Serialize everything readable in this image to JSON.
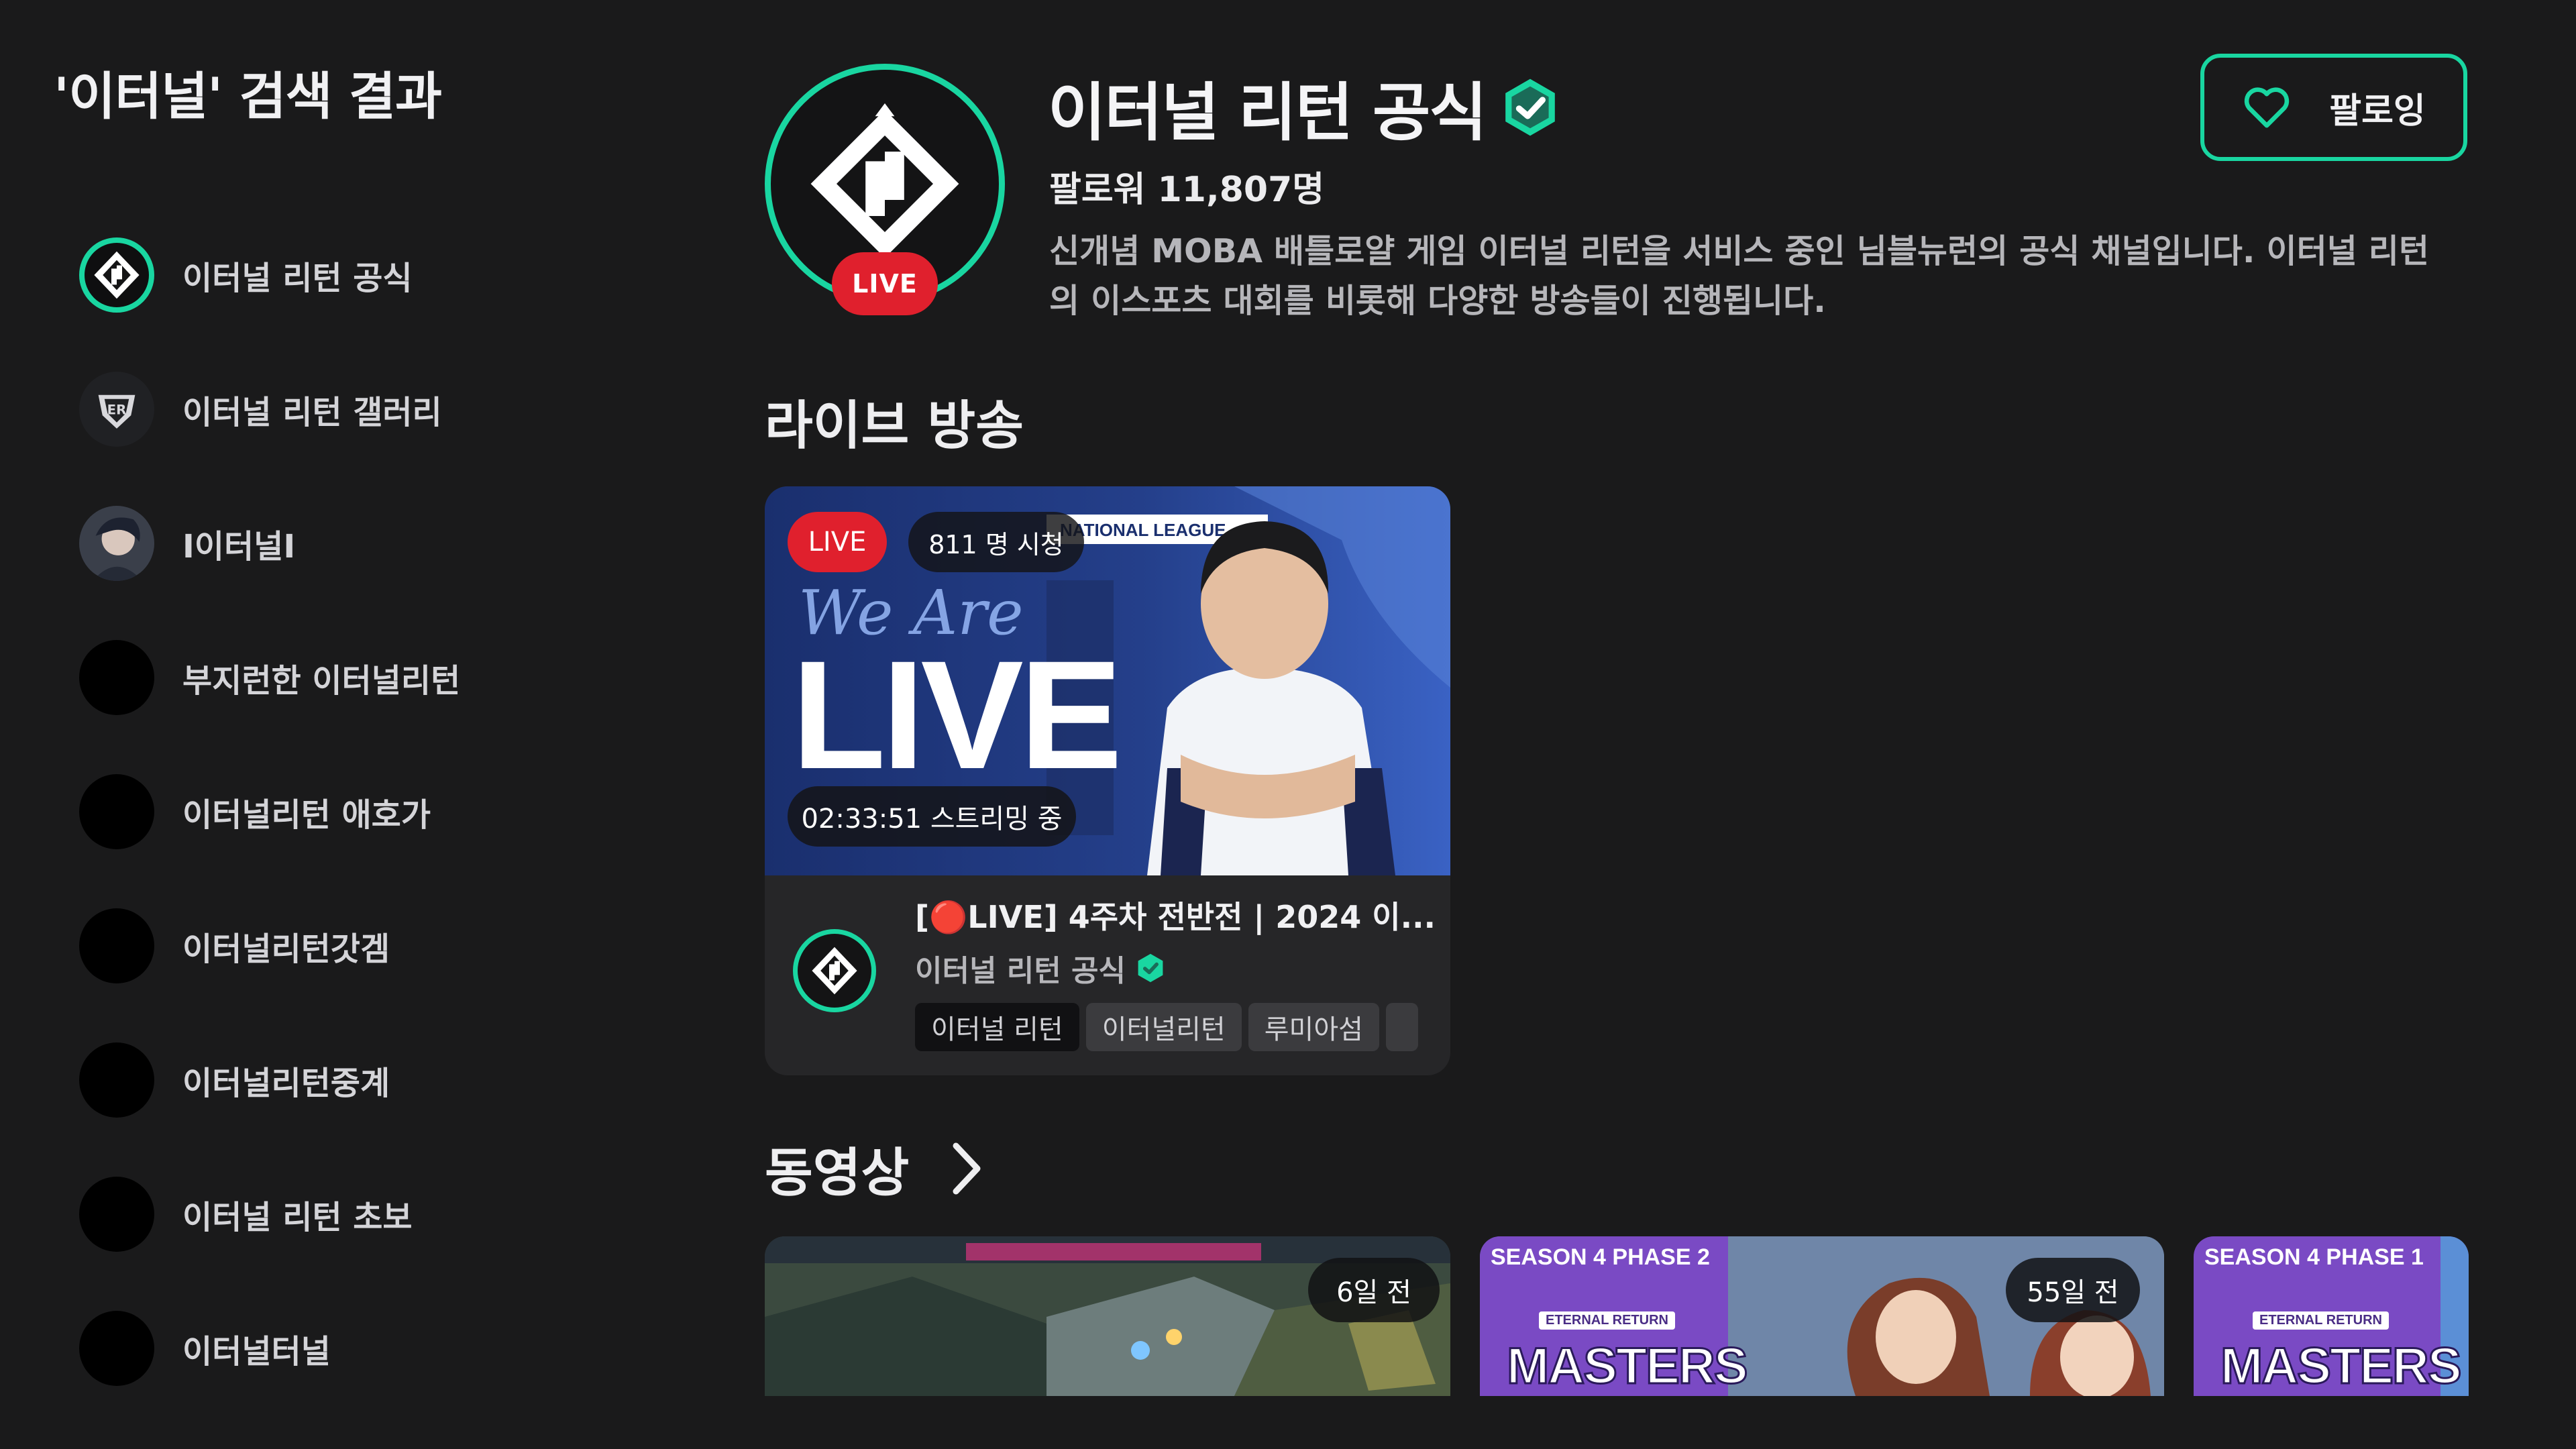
{
  "sidebar": {
    "search_title": "'이터널' 검색 결과",
    "items": [
      {
        "label": "이터널 리턴 공식",
        "avatar": "eternal-return-logo"
      },
      {
        "label": "이터널 리턴 갤러리",
        "avatar": "gallery-shield-logo"
      },
      {
        "label": "I이터널I",
        "avatar": "character-portrait"
      },
      {
        "label": "부지런한 이터널리턴",
        "avatar": "default-black"
      },
      {
        "label": "이터널리턴 애호가",
        "avatar": "default-black"
      },
      {
        "label": "이터널리턴갓겜",
        "avatar": "default-black"
      },
      {
        "label": "이터널리턴중계",
        "avatar": "default-black"
      },
      {
        "label": "이터널 리턴 초보",
        "avatar": "default-black"
      },
      {
        "label": "이터널터널",
        "avatar": "default-black"
      }
    ]
  },
  "channel": {
    "name": "이터널 리턴 공식",
    "live_badge": "LIVE",
    "followers": "팔로워 11,807명",
    "description": "신개념 MOBA 배틀로얄 게임 이터널 리턴을 서비스 중인 님블뉴런의 공식 채널입니다. 이터널 리턴의 이스포츠 대회를 비롯해 다양한 방송들이 진행됩니다.",
    "follow_label": "팔로잉",
    "follow_icon": "heart-outline-icon",
    "verified_icon": "verified-badge-icon"
  },
  "live_section": {
    "title": "라이브 방송",
    "card": {
      "live_pill": "LIVE",
      "viewers": "811 명 시청",
      "duration": "02:33:51 스트리밍 중",
      "thumb_league": "NATIONAL LEAGUE",
      "thumb_text_script": "We Are",
      "thumb_text_big": "LIVE",
      "title": "[🔴LIVE] 4주차 전반전 | 2024 이...",
      "channel": "이터널 리턴 공식",
      "tags": [
        "이터널 리턴",
        "이터널리턴",
        "루미아섬"
      ]
    }
  },
  "video_section": {
    "title": "동영상",
    "arrow_icon": "chevron-right-icon",
    "videos": [
      {
        "age": "6일 전",
        "kind": "gameplay"
      },
      {
        "age": "55일 전",
        "season": "SEASON 4 PHASE 2",
        "sub": "ETERNAL RETURN",
        "word": "MASTERS"
      },
      {
        "season": "SEASON 4 PHASE 1",
        "sub": "ETERNAL RETURN",
        "word": "MASTERS"
      }
    ]
  },
  "colors": {
    "accent": "#19d6a1",
    "live_red": "#e0202d",
    "background": "#1a1a1b",
    "card": "#262628"
  }
}
